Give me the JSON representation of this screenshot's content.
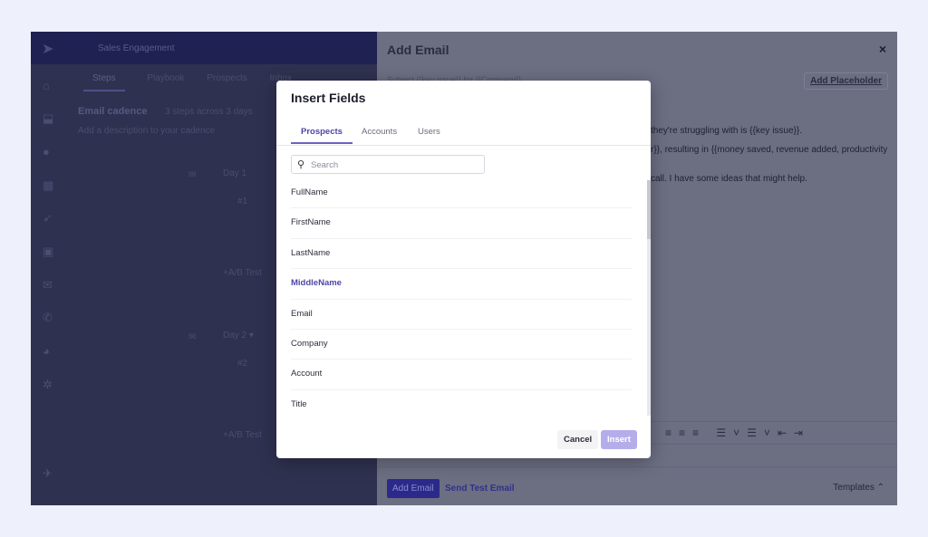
{
  "app": {
    "title": "Sales Engagement",
    "tabs": [
      "Steps",
      "Playbook",
      "Prospects",
      "Inbox"
    ],
    "cadence_title": "Email cadence",
    "cadence_meta": "3 steps across 3 days",
    "description_placeholder": "Add a description to your cadence",
    "day1": "Day 1",
    "step1": "#1",
    "day2": "Day 2 ▾",
    "step2": "#2",
    "ab_test": "+A/B Test"
  },
  "email_panel": {
    "title": "Add Email",
    "close": "×",
    "subject": "Subject    {{key issue}} for {{Company}}",
    "add_placeholder": "Add Placeholder",
    "body_lines": [
      "they're struggling with is {{key issue}}.",
      "r}}, resulting in {{money saved, revenue added, productivity",
      "call. I have some ideas that might help."
    ],
    "add_email": "Add Email",
    "send_test": "Send Test Email",
    "templates": "Templates ⌃"
  },
  "modal": {
    "title": "Insert Fields",
    "tabs": [
      "Prospects",
      "Accounts",
      "Users"
    ],
    "active_tab": "Prospects",
    "search_placeholder": "Search",
    "fields": [
      "FullName",
      "FirstName",
      "LastName",
      "MiddleName",
      "Email",
      "Company",
      "Account",
      "Title"
    ],
    "highlighted": "MiddleName",
    "cancel": "Cancel",
    "insert": "Insert"
  },
  "colors": {
    "accent": "#4d46a8",
    "insert_disabled": "#b3aeea"
  }
}
